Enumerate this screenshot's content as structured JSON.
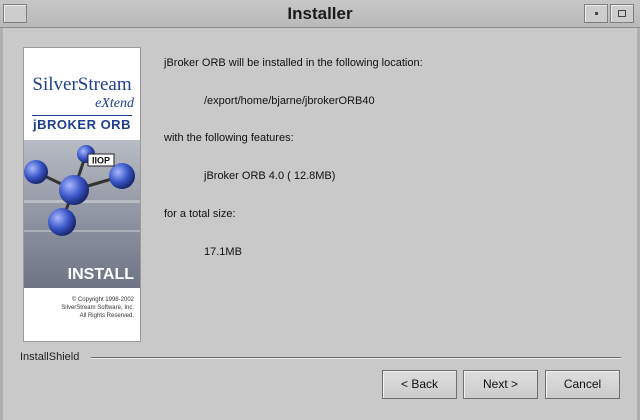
{
  "window": {
    "title": "Installer"
  },
  "sidebar": {
    "logo_line1": "SilverStream",
    "logo_line2": "eXtend",
    "logo_line3": "jBROKER ORB",
    "badge": "IIOP",
    "install_label": "INSTALL",
    "copyright": [
      "© Copyright 1998-2002",
      "SilverStream Software, Inc.",
      "All Rights Reserved."
    ]
  },
  "content": {
    "line1": "jBroker ORB will be installed in the following location:",
    "location": "/export/home/bjarne/jbrokerORB40",
    "line2": "with the following features:",
    "feature": "jBroker ORB 4.0 ( 12.8MB)",
    "line3": "for a total size:",
    "total": "17.1MB"
  },
  "footer": {
    "brand": "InstallShield"
  },
  "buttons": {
    "back": "< Back",
    "next": "Next >",
    "cancel": "Cancel"
  },
  "colors": {
    "accent": "#1f3f8f",
    "sphere": "#3a56c8"
  }
}
